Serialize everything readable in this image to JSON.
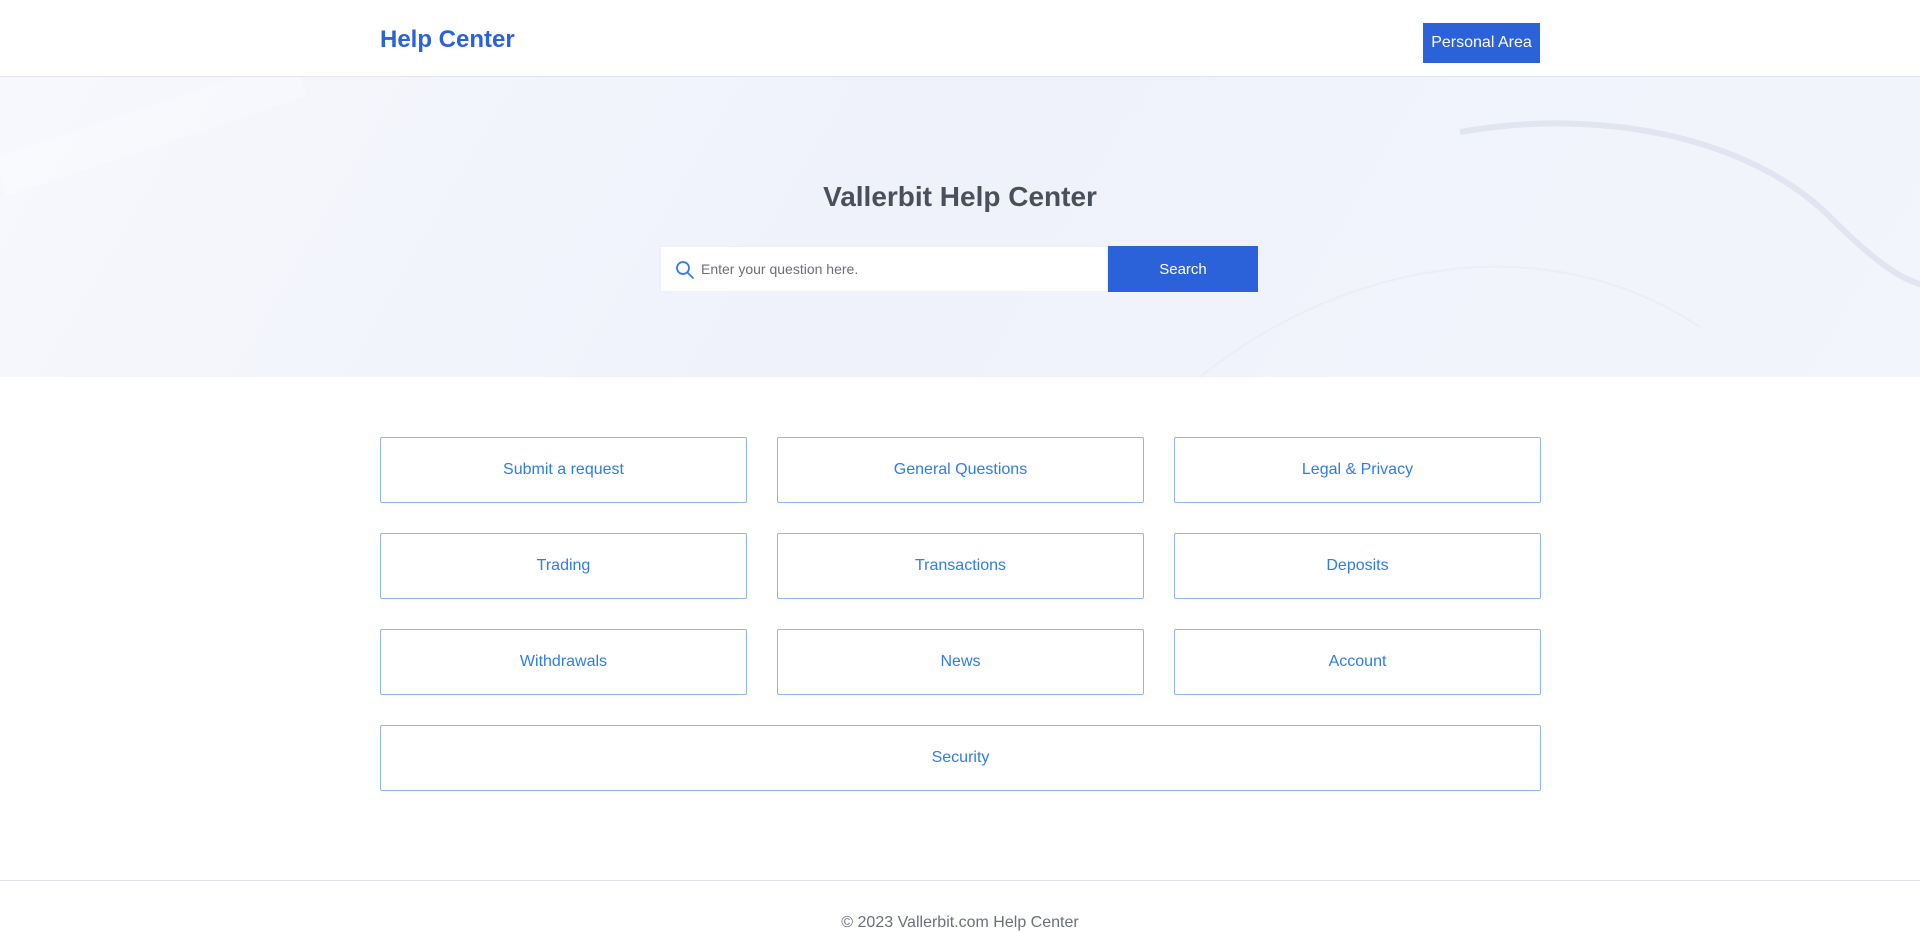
{
  "header": {
    "logo_text": "Help Center",
    "personal_area_label": "Personal Area"
  },
  "hero": {
    "title": "Vallerbit Help Center",
    "search": {
      "placeholder": "Enter your question here.",
      "value": "",
      "button_label": "Search"
    }
  },
  "categories": [
    {
      "label": "Submit a request"
    },
    {
      "label": "General Questions"
    },
    {
      "label": "Legal & Privacy"
    },
    {
      "label": "Trading"
    },
    {
      "label": "Transactions"
    },
    {
      "label": "Deposits"
    },
    {
      "label": "Withdrawals"
    },
    {
      "label": "News"
    },
    {
      "label": "Account"
    },
    {
      "label": "Security"
    }
  ],
  "footer": {
    "copyright": "© 2023 Vallerbit.com Help Center"
  },
  "colors": {
    "brand": "#2b62d9",
    "category_text": "#2f7ce8",
    "category_border": "#8db4f5"
  },
  "icons": {
    "search": "search-icon"
  }
}
